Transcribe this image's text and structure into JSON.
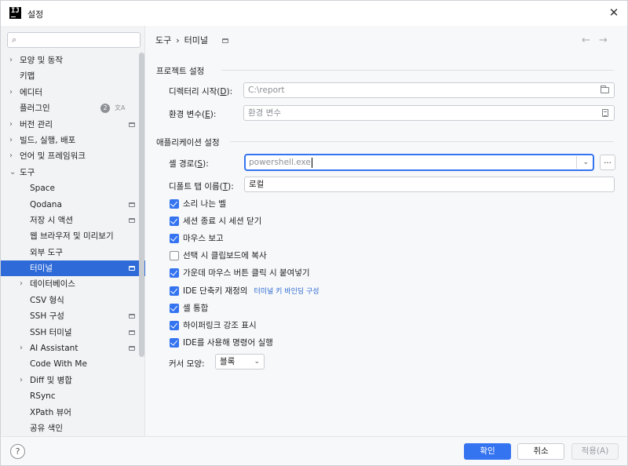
{
  "window": {
    "title": "설정",
    "logo_text": "IJ"
  },
  "sidebar": {
    "search_placeholder": "",
    "items": [
      {
        "label": "모양 및 동작",
        "indent": 0,
        "arrow": "›"
      },
      {
        "label": "키맵",
        "indent": 0,
        "arrow": ""
      },
      {
        "label": "에디터",
        "indent": 0,
        "arrow": "›"
      },
      {
        "label": "플러그인",
        "indent": 0,
        "arrow": "",
        "badge": "2"
      },
      {
        "label": "버전 관리",
        "indent": 0,
        "arrow": "›",
        "proj": true
      },
      {
        "label": "빌드, 실행, 배포",
        "indent": 0,
        "arrow": "›"
      },
      {
        "label": "언어 및 프레임워크",
        "indent": 0,
        "arrow": "›"
      },
      {
        "label": "도구",
        "indent": 0,
        "arrow": "⌄"
      },
      {
        "label": "Space",
        "indent": 1,
        "arrow": ""
      },
      {
        "label": "Qodana",
        "indent": 1,
        "arrow": "",
        "proj": true
      },
      {
        "label": "저장 시 액션",
        "indent": 1,
        "arrow": "",
        "proj": true
      },
      {
        "label": "웹 브라우저 및 미리보기",
        "indent": 1,
        "arrow": ""
      },
      {
        "label": "외부 도구",
        "indent": 1,
        "arrow": ""
      },
      {
        "label": "터미널",
        "indent": 1,
        "arrow": "",
        "proj": true,
        "selected": true
      },
      {
        "label": "데이터베이스",
        "indent": 1,
        "arrow": "›"
      },
      {
        "label": "CSV 형식",
        "indent": 1,
        "arrow": ""
      },
      {
        "label": "SSH 구성",
        "indent": 1,
        "arrow": "",
        "proj": true
      },
      {
        "label": "SSH 터미널",
        "indent": 1,
        "arrow": "",
        "proj": true
      },
      {
        "label": "AI Assistant",
        "indent": 1,
        "arrow": "›",
        "proj": true
      },
      {
        "label": "Code With Me",
        "indent": 1,
        "arrow": ""
      },
      {
        "label": "Diff 및 병합",
        "indent": 1,
        "arrow": "›"
      },
      {
        "label": "RSync",
        "indent": 1,
        "arrow": ""
      },
      {
        "label": "XPath 뷰어",
        "indent": 1,
        "arrow": ""
      },
      {
        "label": "공유 색인",
        "indent": 1,
        "arrow": ""
      }
    ]
  },
  "breadcrumb": {
    "parent": "도구",
    "separator": "›",
    "current": "터미널"
  },
  "project_section": {
    "title": "프로젝트 설정",
    "start_dir_label": "디렉터리 시작(",
    "start_dir_key": "D",
    "start_dir_suffix": "):",
    "start_dir_value": "C:\\report",
    "env_label": "환경 변수(",
    "env_key": "E",
    "env_suffix": "):",
    "env_placeholder": "환경 변수"
  },
  "app_section": {
    "title": "애플리케이션 설정",
    "shell_label": "셸 경로(",
    "shell_key": "S",
    "shell_suffix": "):",
    "shell_value": "powershell.exe",
    "ellipsis": "...",
    "tab_label": "디폴트 탭 이름(",
    "tab_key": "T",
    "tab_suffix": "):",
    "tab_value": "로컬",
    "checkboxes": [
      {
        "label": "소리 나는 벨",
        "checked": true
      },
      {
        "label": "세션 종료 시 세션 닫기",
        "checked": true
      },
      {
        "label": "마우스 보고",
        "checked": true
      },
      {
        "label": "선택 시 클립보드에 복사",
        "checked": false
      },
      {
        "label": "가운데 마우스 버튼 클릭 시 붙여넣기",
        "checked": true
      },
      {
        "label": "IDE 단축키 재정의",
        "checked": true,
        "link": "터미널 키 바인딩 구성"
      },
      {
        "label": "셸 통합",
        "checked": true
      },
      {
        "label": "하이퍼링크 강조 표시",
        "checked": true
      },
      {
        "label": "IDE를 사용해 명령어 실행",
        "checked": true
      }
    ],
    "cursor_label": "커서 모양:",
    "cursor_value": "블록"
  },
  "footer": {
    "help": "?",
    "ok": "확인",
    "cancel": "취소",
    "apply": "적용(A)"
  },
  "colors": {
    "accent": "#3574f0",
    "selection": "#2f6bd8",
    "link": "#2e6bd1"
  }
}
